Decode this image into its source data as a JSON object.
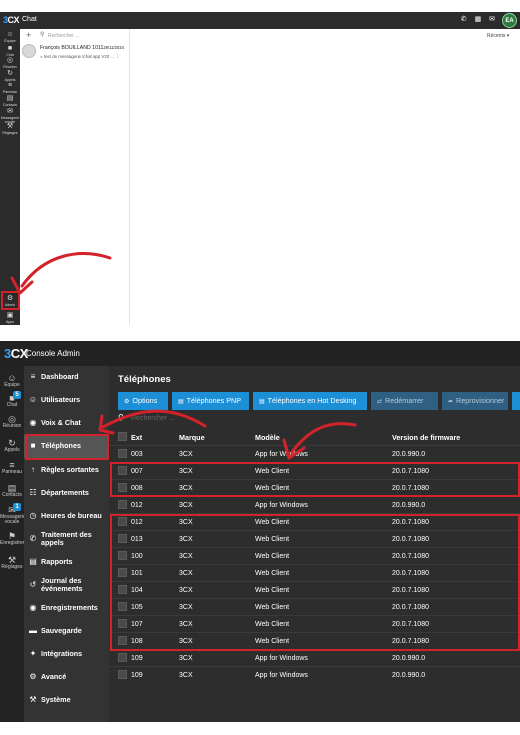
{
  "chat": {
    "logo": "3CX",
    "title": "Chat",
    "top_icons": "✆ ▦ ✉",
    "avatar": "EA",
    "sidebar": [
      {
        "icon": "☺",
        "label": "Équipe"
      },
      {
        "icon": "■",
        "label": "Chat"
      },
      {
        "icon": "◎",
        "label": "Réunion"
      },
      {
        "icon": "↻",
        "label": "Appels"
      },
      {
        "icon": "≡",
        "label": "Panneau"
      },
      {
        "icon": "▤",
        "label": "Contacts"
      },
      {
        "icon": "✉",
        "label": "Messagerie vocale"
      },
      {
        "icon": "⚒",
        "label": "Réglages"
      },
      {
        "icon": "⚙",
        "label": "Admin"
      },
      {
        "icon": "▣",
        "label": "Apps"
      }
    ],
    "search_placeholder": "Rechercher ...",
    "recents_label": "Récents",
    "conversation": {
      "name": "François BOUILLAND 1011",
      "date": "29/11/2024",
      "preview": "test de messagerie tchat app V20 ...",
      "menu": "⋮"
    }
  },
  "admin": {
    "logo": "3CX",
    "title": "Console Admin",
    "sidebar": [
      {
        "icon": "☺",
        "label": "Équipe"
      },
      {
        "icon": "■",
        "label": "Chat",
        "badge": "5"
      },
      {
        "icon": "◎",
        "label": "Réunion"
      },
      {
        "icon": "↻",
        "label": "Appels"
      },
      {
        "icon": "≡",
        "label": "Panneau"
      },
      {
        "icon": "▤",
        "label": "Contacts"
      },
      {
        "icon": "✉",
        "label": "Messagerie vocale",
        "badge": "1"
      },
      {
        "icon": "⚑",
        "label": "Enregistrements"
      },
      {
        "icon": "⚒",
        "label": "Réglages"
      }
    ],
    "menu": [
      {
        "icon": "≡",
        "label": "Dashboard"
      },
      {
        "icon": "☺",
        "label": "Utilisateurs"
      },
      {
        "icon": "◉",
        "label": "Voix & Chat"
      },
      {
        "icon": "■",
        "label": "Téléphones",
        "active": true
      },
      {
        "icon": "↑",
        "label": "Règles sortantes"
      },
      {
        "icon": "☷",
        "label": "Départements"
      },
      {
        "icon": "◷",
        "label": "Heures de bureau"
      },
      {
        "icon": "✆",
        "label": "Traitement des appels"
      },
      {
        "icon": "▤",
        "label": "Rapports"
      },
      {
        "icon": "↺",
        "label": "Journal des événements"
      },
      {
        "icon": "◉",
        "label": "Enregistrements"
      },
      {
        "icon": "▬",
        "label": "Sauvegarde"
      },
      {
        "icon": "✦",
        "label": "Intégrations"
      },
      {
        "icon": "⚙",
        "label": "Avancé"
      },
      {
        "icon": "⚒",
        "label": "Système"
      }
    ],
    "page_title": "Téléphones",
    "toolbar": [
      {
        "icon": "⚙",
        "label": "Options",
        "enabled": true
      },
      {
        "icon": "▤",
        "label": "Téléphones PNP",
        "enabled": true
      },
      {
        "icon": "▤",
        "label": "Téléphones en Hot Desking",
        "enabled": true
      },
      {
        "icon": "⇄",
        "label": "Redémarrer",
        "enabled": false
      },
      {
        "icon": "➦",
        "label": "Reprovisionner",
        "enabled": false
      }
    ],
    "search_placeholder": "Rechercher ...",
    "columns": [
      "Ext",
      "Marque",
      "Modèle",
      "Version de firmware"
    ],
    "rows": [
      {
        "ext": "003",
        "brand": "3CX",
        "model": "App for Windows",
        "firmware": "20.0.990.0"
      },
      {
        "ext": "007",
        "brand": "3CX",
        "model": "Web Client",
        "firmware": "20.0.7.1080"
      },
      {
        "ext": "008",
        "brand": "3CX",
        "model": "Web Client",
        "firmware": "20.0.7.1080"
      },
      {
        "ext": "012",
        "brand": "3CX",
        "model": "App for Windows",
        "firmware": "20.0.990.0"
      },
      {
        "ext": "012",
        "brand": "3CX",
        "model": "Web Client",
        "firmware": "20.0.7.1080"
      },
      {
        "ext": "013",
        "brand": "3CX",
        "model": "Web Client",
        "firmware": "20.0.7.1080"
      },
      {
        "ext": "100",
        "brand": "3CX",
        "model": "Web Client",
        "firmware": "20.0.7.1080"
      },
      {
        "ext": "101",
        "brand": "3CX",
        "model": "Web Client",
        "firmware": "20.0.7.1080"
      },
      {
        "ext": "104",
        "brand": "3CX",
        "model": "Web Client",
        "firmware": "20.0.7.1080"
      },
      {
        "ext": "105",
        "brand": "3CX",
        "model": "Web Client",
        "firmware": "20.0.7.1080"
      },
      {
        "ext": "107",
        "brand": "3CX",
        "model": "Web Client",
        "firmware": "20.0.7.1080"
      },
      {
        "ext": "108",
        "brand": "3CX",
        "model": "Web Client",
        "firmware": "20.0.7.1080"
      },
      {
        "ext": "109",
        "brand": "3CX",
        "model": "App for Windows",
        "firmware": "20.0.990.0"
      },
      {
        "ext": "109",
        "brand": "3CX",
        "model": "App for Windows",
        "firmware": "20.0.990.0"
      }
    ],
    "highlight_color": "#d2232a",
    "accent_color": "#1d8fd6"
  }
}
